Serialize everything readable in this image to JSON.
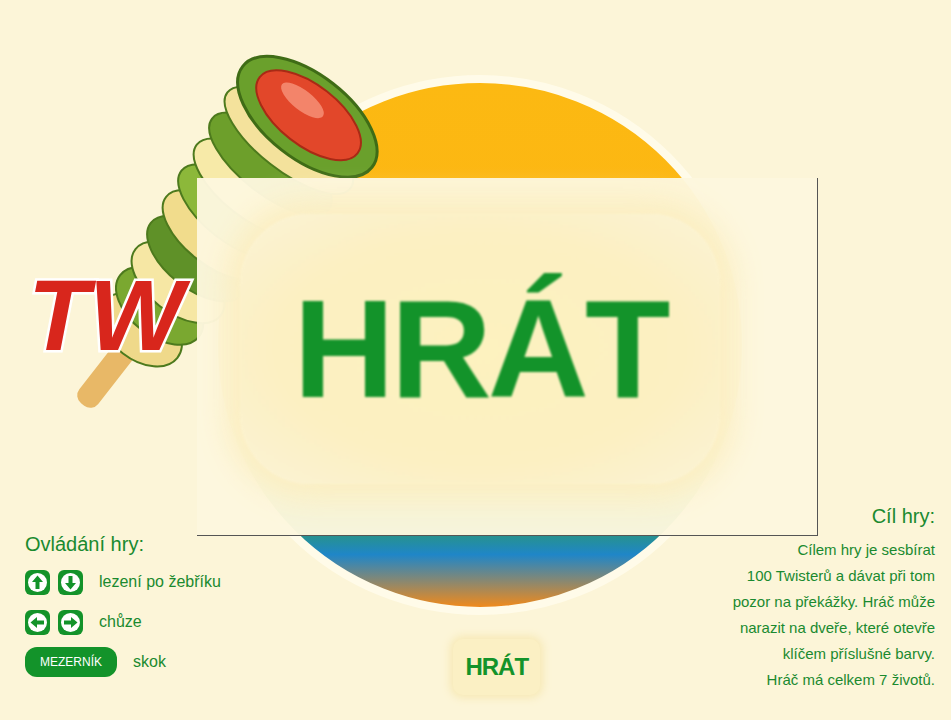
{
  "logo": "TW",
  "play_button": {
    "label": "HRÁT"
  },
  "controls": {
    "title": "Ovládání hry:",
    "items": [
      {
        "kind": "updown",
        "label": "lezení po žebříku"
      },
      {
        "kind": "leftright",
        "label": "chůze"
      },
      {
        "kind": "space",
        "key": "MEZERNÍK",
        "label": "skok"
      }
    ]
  },
  "small_play_button": {
    "label": "HRÁT"
  },
  "goal": {
    "title": "Cíl hry:",
    "lines": [
      "Cílem hry je sesbírat",
      "100 Twisterů a dávat při tom",
      "pozor na překážky. Hráč může",
      "narazit na dveře, které otevře",
      "klíčem příslušné barvy.",
      "Hráč má celkem 7 životů."
    ]
  }
}
